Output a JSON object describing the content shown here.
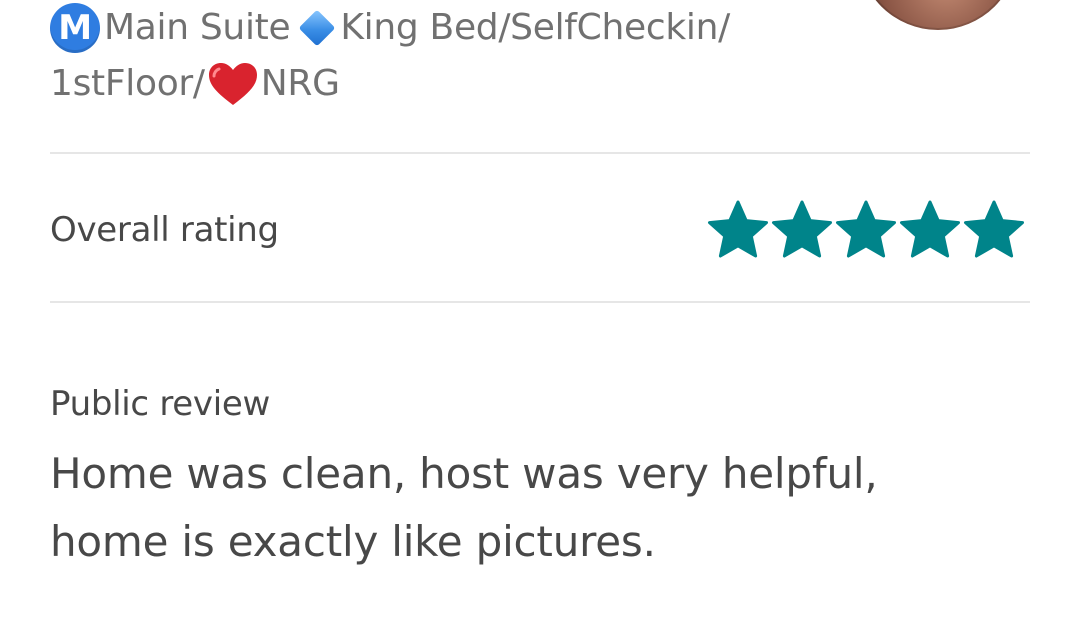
{
  "listing": {
    "title_line1": {
      "m_badge": "M",
      "part1": "Main Suite",
      "part2": "King Bed/SelfCheckin/"
    },
    "title_line2": {
      "part1": "1stFloor/",
      "part2": "NRG"
    },
    "icons": [
      "m-circle-icon",
      "blue-diamond-icon",
      "red-heart-icon"
    ]
  },
  "host": {
    "avatar": "avatar-photo"
  },
  "rating": {
    "label": "Overall rating",
    "stars": 5,
    "max_stars": 5,
    "star_color": "#00848a"
  },
  "review": {
    "label": "Public review",
    "text_line1": "Home was clean, host was very helpful,",
    "text_line2": "home is exactly like pictures."
  },
  "colors": {
    "secondary_text": "#717171",
    "primary_text": "#484848",
    "divider": "#e6e6e6",
    "accent_teal": "#00848a"
  }
}
